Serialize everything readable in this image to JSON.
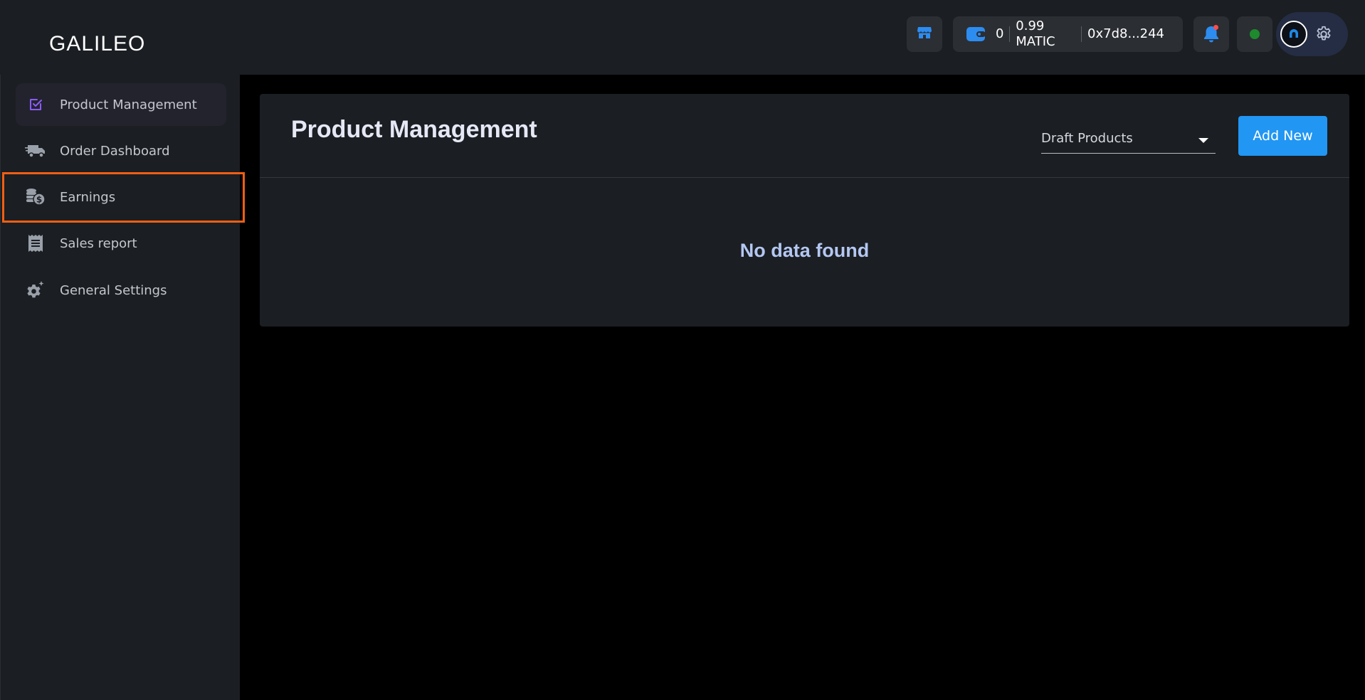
{
  "app": {
    "logo_text": "GALILEO"
  },
  "header": {
    "wallet": {
      "count": "0",
      "balance": "0.99 MATIC",
      "address": "0x7d8...244"
    },
    "status_color": "#1e8a2e",
    "accent_color": "#2196f3",
    "notification_dot_color": "#ff4d4f"
  },
  "sidebar": {
    "items": [
      {
        "label": "Product Management",
        "icon": "checkbox-icon",
        "active": true
      },
      {
        "label": "Order Dashboard",
        "icon": "delivery-truck-icon",
        "active": false
      },
      {
        "label": "Earnings",
        "icon": "coins-dollar-icon",
        "active": false,
        "highlighted": true
      },
      {
        "label": "Sales report",
        "icon": "receipt-icon",
        "active": false
      },
      {
        "label": "General Settings",
        "icon": "gear-icon",
        "active": false
      }
    ]
  },
  "main": {
    "title": "Product Management",
    "filter": {
      "selected": "Draft Products"
    },
    "add_button_label": "Add New",
    "empty_message": "No data found"
  }
}
